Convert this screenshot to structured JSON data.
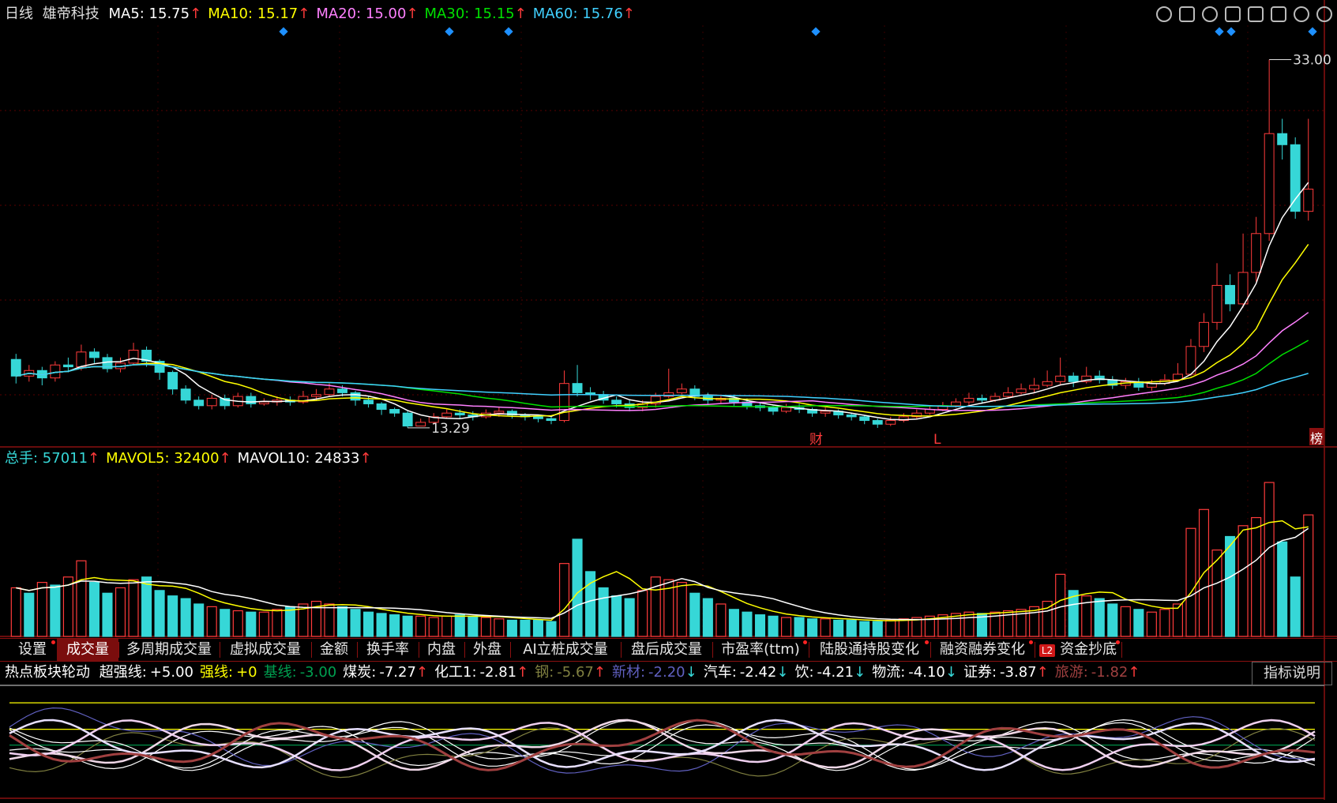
{
  "header": {
    "period": "日线",
    "stock": "雄帝科技",
    "ma": [
      {
        "label": "MA5:",
        "value": "15.75",
        "color": "#ffffff"
      },
      {
        "label": "MA10:",
        "value": "15.17",
        "color": "#ffff00"
      },
      {
        "label": "MA20:",
        "value": "15.00",
        "color": "#ff80ff"
      },
      {
        "label": "MA30:",
        "value": "15.15",
        "color": "#00e000"
      },
      {
        "label": "MA60:",
        "value": "15.76",
        "color": "#40d0ff"
      }
    ]
  },
  "toolbar_icons": [
    "eye-icon",
    "scissors-icon",
    "play-icon",
    "lock-icon",
    "hand-icon",
    "undo-icon",
    "zoom-in-icon",
    "zoom-out-icon"
  ],
  "price_annotations": {
    "high": "33.00",
    "low": "13.29",
    "markers": [
      "财",
      "L",
      "榜"
    ]
  },
  "volume_header": {
    "items": [
      {
        "label": "总手:",
        "value": "57011",
        "color": "#36d7d7"
      },
      {
        "label": "MAVOL5:",
        "value": "32400",
        "color": "#ffff00"
      },
      {
        "label": "MAVOL10:",
        "value": "24833",
        "color": "#ffffff"
      }
    ]
  },
  "tabs": [
    {
      "label": "设置",
      "dot": true
    },
    {
      "label": "成交量",
      "dot": false,
      "active": true
    },
    {
      "label": "多周期成交量",
      "dot": false
    },
    {
      "label": "虚拟成交量",
      "dot": false
    },
    {
      "label": "金额",
      "dot": false
    },
    {
      "label": "换手率",
      "dot": false
    },
    {
      "label": "内盘",
      "dot": false
    },
    {
      "label": "外盘",
      "dot": false
    },
    {
      "label": "AI立桩成交量",
      "dot": false
    },
    {
      "label": "盘后成交量",
      "dot": false
    },
    {
      "label": "市盈率(ttm)",
      "dot": true
    },
    {
      "label": "陆股通持股变化",
      "dot": true
    },
    {
      "label": "融资融券变化",
      "dot": true
    },
    {
      "label": "资金抄底",
      "dot": true,
      "badge": "L2"
    }
  ],
  "indicator_header": {
    "title": "热点板块轮动",
    "items": [
      {
        "label": "超强线:",
        "value": "+5.00",
        "color": "#ffffff"
      },
      {
        "label": "强线:",
        "value": "+0",
        "color": "#ffff00"
      },
      {
        "label": "基线:",
        "value": "-3.00",
        "color": "#00a050"
      },
      {
        "label": "煤炭:",
        "value": "-7.27",
        "color": "#ffffff",
        "arrow": "up"
      },
      {
        "label": "化工1:",
        "value": "-2.81",
        "color": "#ffffff",
        "arrow": "up"
      },
      {
        "label": "钢:",
        "value": "-5.67",
        "color": "#808040",
        "arrow": "up"
      },
      {
        "label": "新材:",
        "value": "-2.20",
        "color": "#6060c0",
        "arrow": "down"
      },
      {
        "label": "汽车:",
        "value": "-2.42",
        "color": "#ffffff",
        "arrow": "down"
      },
      {
        "label": "饮:",
        "value": "-4.21",
        "color": "#ffffff",
        "arrow": "down"
      },
      {
        "label": "物流:",
        "value": "-4.10",
        "color": "#ffffff",
        "arrow": "down"
      },
      {
        "label": "证券:",
        "value": "-3.87",
        "color": "#ffffff",
        "arrow": "up"
      },
      {
        "label": "旅游:",
        "value": "-1.82",
        "color": "#a04040",
        "arrow": "up"
      }
    ],
    "explain": "指标说明"
  },
  "chart_data": [
    {
      "type": "candlestick",
      "title": "雄帝科技",
      "ylim": [
        12.5,
        34
      ],
      "up_color": "#ff3b3b",
      "down_color": "#36d7d7",
      "candles": [
        [
          16.8,
          15.9,
          17.1,
          15.5
        ],
        [
          15.9,
          16.2,
          16.5,
          15.6
        ],
        [
          16.2,
          15.8,
          16.4,
          15.4
        ],
        [
          15.8,
          16.5,
          16.7,
          15.6
        ],
        [
          16.5,
          16.4,
          16.9,
          16.1
        ],
        [
          16.4,
          17.2,
          17.6,
          16.2
        ],
        [
          17.2,
          16.9,
          17.4,
          16.6
        ],
        [
          16.9,
          16.3,
          17.1,
          16.1
        ],
        [
          16.3,
          16.6,
          16.9,
          16.1
        ],
        [
          16.6,
          17.3,
          17.7,
          16.5
        ],
        [
          17.3,
          16.7,
          17.5,
          16.4
        ],
        [
          16.7,
          16.1,
          16.8,
          15.7
        ],
        [
          16.1,
          15.2,
          16.2,
          14.9
        ],
        [
          15.2,
          14.6,
          15.4,
          14.4
        ],
        [
          14.6,
          14.3,
          14.8,
          14.1
        ],
        [
          14.3,
          14.7,
          14.9,
          14.1
        ],
        [
          14.7,
          14.3,
          14.9,
          14.1
        ],
        [
          14.3,
          14.8,
          15.0,
          14.2
        ],
        [
          14.8,
          14.4,
          15.0,
          14.2
        ],
        [
          14.4,
          14.5,
          14.7,
          14.3
        ],
        [
          14.5,
          14.6,
          14.8,
          14.3
        ],
        [
          14.6,
          14.5,
          14.8,
          14.3
        ],
        [
          14.5,
          14.8,
          15.1,
          14.4
        ],
        [
          14.8,
          14.9,
          15.2,
          14.6
        ],
        [
          14.9,
          15.2,
          15.5,
          14.8
        ],
        [
          15.2,
          15.0,
          15.4,
          14.8
        ],
        [
          15.0,
          14.6,
          15.1,
          14.3
        ],
        [
          14.6,
          14.4,
          14.8,
          14.2
        ],
        [
          14.4,
          14.1,
          14.5,
          13.8
        ],
        [
          14.1,
          13.9,
          14.2,
          13.7
        ],
        [
          13.9,
          13.2,
          14.0,
          13.1
        ],
        [
          13.2,
          13.4,
          13.6,
          13.29
        ],
        [
          13.4,
          13.7,
          13.9,
          13.3
        ],
        [
          13.7,
          13.9,
          14.1,
          13.6
        ],
        [
          13.9,
          13.8,
          14.1,
          13.6
        ],
        [
          13.8,
          13.7,
          14.0,
          13.5
        ],
        [
          13.7,
          13.9,
          14.1,
          13.6
        ],
        [
          13.9,
          14.0,
          14.2,
          13.7
        ],
        [
          14.0,
          13.8,
          14.1,
          13.6
        ],
        [
          13.8,
          13.7,
          13.9,
          13.5
        ],
        [
          13.7,
          13.6,
          13.8,
          13.4
        ],
        [
          13.6,
          13.5,
          13.7,
          13.3
        ],
        [
          13.5,
          15.5,
          16.2,
          13.4
        ],
        [
          15.5,
          15.0,
          16.5,
          14.8
        ],
        [
          15.0,
          14.9,
          15.3,
          14.6
        ],
        [
          14.9,
          14.6,
          15.1,
          14.4
        ],
        [
          14.6,
          14.4,
          14.8,
          14.2
        ],
        [
          14.4,
          14.2,
          14.6,
          14.0
        ],
        [
          14.2,
          14.4,
          14.6,
          14.0
        ],
        [
          14.4,
          14.8,
          15.0,
          14.2
        ],
        [
          14.8,
          15.0,
          16.3,
          14.7
        ],
        [
          15.0,
          15.2,
          15.5,
          14.9
        ],
        [
          15.2,
          14.8,
          15.4,
          14.6
        ],
        [
          14.8,
          14.6,
          15.0,
          14.4
        ],
        [
          14.6,
          14.7,
          14.9,
          14.4
        ],
        [
          14.7,
          14.5,
          14.9,
          14.3
        ],
        [
          14.5,
          14.3,
          14.7,
          14.1
        ],
        [
          14.3,
          14.2,
          14.5,
          14.0
        ],
        [
          14.2,
          14.0,
          14.3,
          13.8
        ],
        [
          14.0,
          14.2,
          14.4,
          13.9
        ],
        [
          14.2,
          14.1,
          14.4,
          13.9
        ],
        [
          14.1,
          13.9,
          14.2,
          13.7
        ],
        [
          13.9,
          14.0,
          14.2,
          13.7
        ],
        [
          14.0,
          13.8,
          14.1,
          13.6
        ],
        [
          13.8,
          13.7,
          13.9,
          13.5
        ],
        [
          13.7,
          13.5,
          13.8,
          13.3
        ],
        [
          13.5,
          13.3,
          13.6,
          13.1
        ],
        [
          13.3,
          13.5,
          13.7,
          13.2
        ],
        [
          13.5,
          13.7,
          13.9,
          13.4
        ],
        [
          13.7,
          13.9,
          14.1,
          13.6
        ],
        [
          13.9,
          14.1,
          14.3,
          13.8
        ],
        [
          14.1,
          14.3,
          14.5,
          14.0
        ],
        [
          14.3,
          14.5,
          14.7,
          14.2
        ],
        [
          14.5,
          14.7,
          15.0,
          14.3
        ],
        [
          14.7,
          14.6,
          14.9,
          14.4
        ],
        [
          14.6,
          14.8,
          15.0,
          14.5
        ],
        [
          14.8,
          15.0,
          15.3,
          14.7
        ],
        [
          15.0,
          15.2,
          15.5,
          14.9
        ],
        [
          15.2,
          15.4,
          15.8,
          15.0
        ],
        [
          15.4,
          15.6,
          16.2,
          15.3
        ],
        [
          15.6,
          15.9,
          16.9,
          15.4
        ],
        [
          15.9,
          15.6,
          16.1,
          15.3
        ],
        [
          15.6,
          15.9,
          16.4,
          15.5
        ],
        [
          15.9,
          15.7,
          16.2,
          15.5
        ],
        [
          15.7,
          15.4,
          15.9,
          15.2
        ],
        [
          15.4,
          15.6,
          15.8,
          15.2
        ],
        [
          15.6,
          15.3,
          15.8,
          15.1
        ],
        [
          15.3,
          15.5,
          15.7,
          15.1
        ],
        [
          15.5,
          15.7,
          16.0,
          15.4
        ],
        [
          15.7,
          16.0,
          16.6,
          15.6
        ],
        [
          16.0,
          17.5,
          17.9,
          15.9
        ],
        [
          17.5,
          18.8,
          19.3,
          17.2
        ],
        [
          18.8,
          20.8,
          22.0,
          18.4
        ],
        [
          20.8,
          19.8,
          21.4,
          19.4
        ],
        [
          19.8,
          21.5,
          23.6,
          19.6
        ],
        [
          21.5,
          23.6,
          24.5,
          21.0
        ],
        [
          23.6,
          29.0,
          33.0,
          23.2
        ],
        [
          29.0,
          28.4,
          29.8,
          27.6
        ],
        [
          28.4,
          24.8,
          28.8,
          24.4
        ],
        [
          24.8,
          26.0,
          29.8,
          24.3
        ]
      ],
      "ma_series": [
        {
          "name": "MA5",
          "color": "#ffffff"
        },
        {
          "name": "MA10",
          "color": "#ffff00"
        },
        {
          "name": "MA20",
          "color": "#ff80ff"
        },
        {
          "name": "MA30",
          "color": "#00e000"
        },
        {
          "name": "MA60",
          "color": "#40d0ff"
        }
      ],
      "annotations": [
        "33.00",
        "13.29"
      ]
    },
    {
      "type": "bar",
      "title": "",
      "ylim": [
        0,
        62000
      ],
      "values": [
        18000,
        16000,
        20000,
        19000,
        22000,
        28000,
        20000,
        16000,
        18000,
        21000,
        22000,
        17000,
        15000,
        14000,
        12000,
        11000,
        10000,
        9500,
        9000,
        9000,
        10000,
        11000,
        12000,
        13000,
        12000,
        11000,
        10000,
        9000,
        8500,
        8000,
        7500,
        7500,
        7000,
        7500,
        8000,
        7500,
        7000,
        6500,
        6000,
        6000,
        6000,
        5500,
        27000,
        36000,
        24000,
        18000,
        15000,
        14000,
        17000,
        22000,
        21000,
        20000,
        16000,
        14000,
        12000,
        10000,
        9000,
        8000,
        7500,
        7000,
        7000,
        6500,
        6500,
        6000,
        6000,
        5500,
        5500,
        6000,
        6500,
        7000,
        7500,
        8000,
        8500,
        9000,
        8500,
        9000,
        9500,
        10000,
        11000,
        13000,
        23000,
        17000,
        15000,
        14000,
        12000,
        11000,
        10000,
        9000,
        10000,
        12000,
        40000,
        47000,
        32000,
        37000,
        41000,
        44000,
        57011,
        35000,
        22000,
        45000
      ],
      "direction": [
        1,
        0,
        1,
        0,
        1,
        1,
        0,
        0,
        1,
        1,
        0,
        0,
        0,
        0,
        0,
        1,
        0,
        1,
        0,
        1,
        1,
        0,
        1,
        1,
        1,
        0,
        0,
        0,
        0,
        0,
        0,
        1,
        1,
        1,
        0,
        0,
        1,
        1,
        0,
        0,
        0,
        0,
        1,
        0,
        0,
        0,
        0,
        0,
        1,
        1,
        1,
        1,
        0,
        0,
        1,
        0,
        0,
        0,
        0,
        1,
        0,
        0,
        1,
        0,
        0,
        0,
        0,
        1,
        1,
        1,
        1,
        1,
        1,
        1,
        0,
        1,
        1,
        1,
        1,
        1,
        1,
        0,
        1,
        0,
        0,
        1,
        0,
        1,
        1,
        1,
        1,
        1,
        1,
        0,
        1,
        1,
        1,
        0,
        0,
        1
      ],
      "lines": [
        {
          "name": "MAVOL5",
          "color": "#ffff00"
        },
        {
          "name": "MAVOL10",
          "color": "#ffffff"
        }
      ]
    },
    {
      "type": "line",
      "title": "热点板块轮动",
      "ylim": [
        -12,
        8
      ],
      "hlines": [
        {
          "name": "超强线",
          "value": 5,
          "color": "#ffff00"
        },
        {
          "name": "强线",
          "value": 0,
          "color": "#ffff00"
        },
        {
          "name": "基线",
          "value": -3,
          "color": "#00a050"
        }
      ],
      "series": [
        {
          "name": "煤炭",
          "color": "#ffffff",
          "seed": 1
        },
        {
          "name": "化工1",
          "color": "#ffffff",
          "seed": 2
        },
        {
          "name": "钢",
          "color": "#808040",
          "seed": 3
        },
        {
          "name": "新材",
          "color": "#6060c0",
          "seed": 4
        },
        {
          "name": "汽车",
          "color": "#ffffff",
          "seed": 5
        },
        {
          "name": "饮",
          "color": "#f0d8e8",
          "seed": 6
        },
        {
          "name": "物流",
          "color": "#f0d0f0",
          "seed": 7
        },
        {
          "name": "证券",
          "color": "#e8e0ff",
          "seed": 8
        },
        {
          "name": "旅游",
          "color": "#a04040",
          "seed": 9
        }
      ]
    }
  ]
}
